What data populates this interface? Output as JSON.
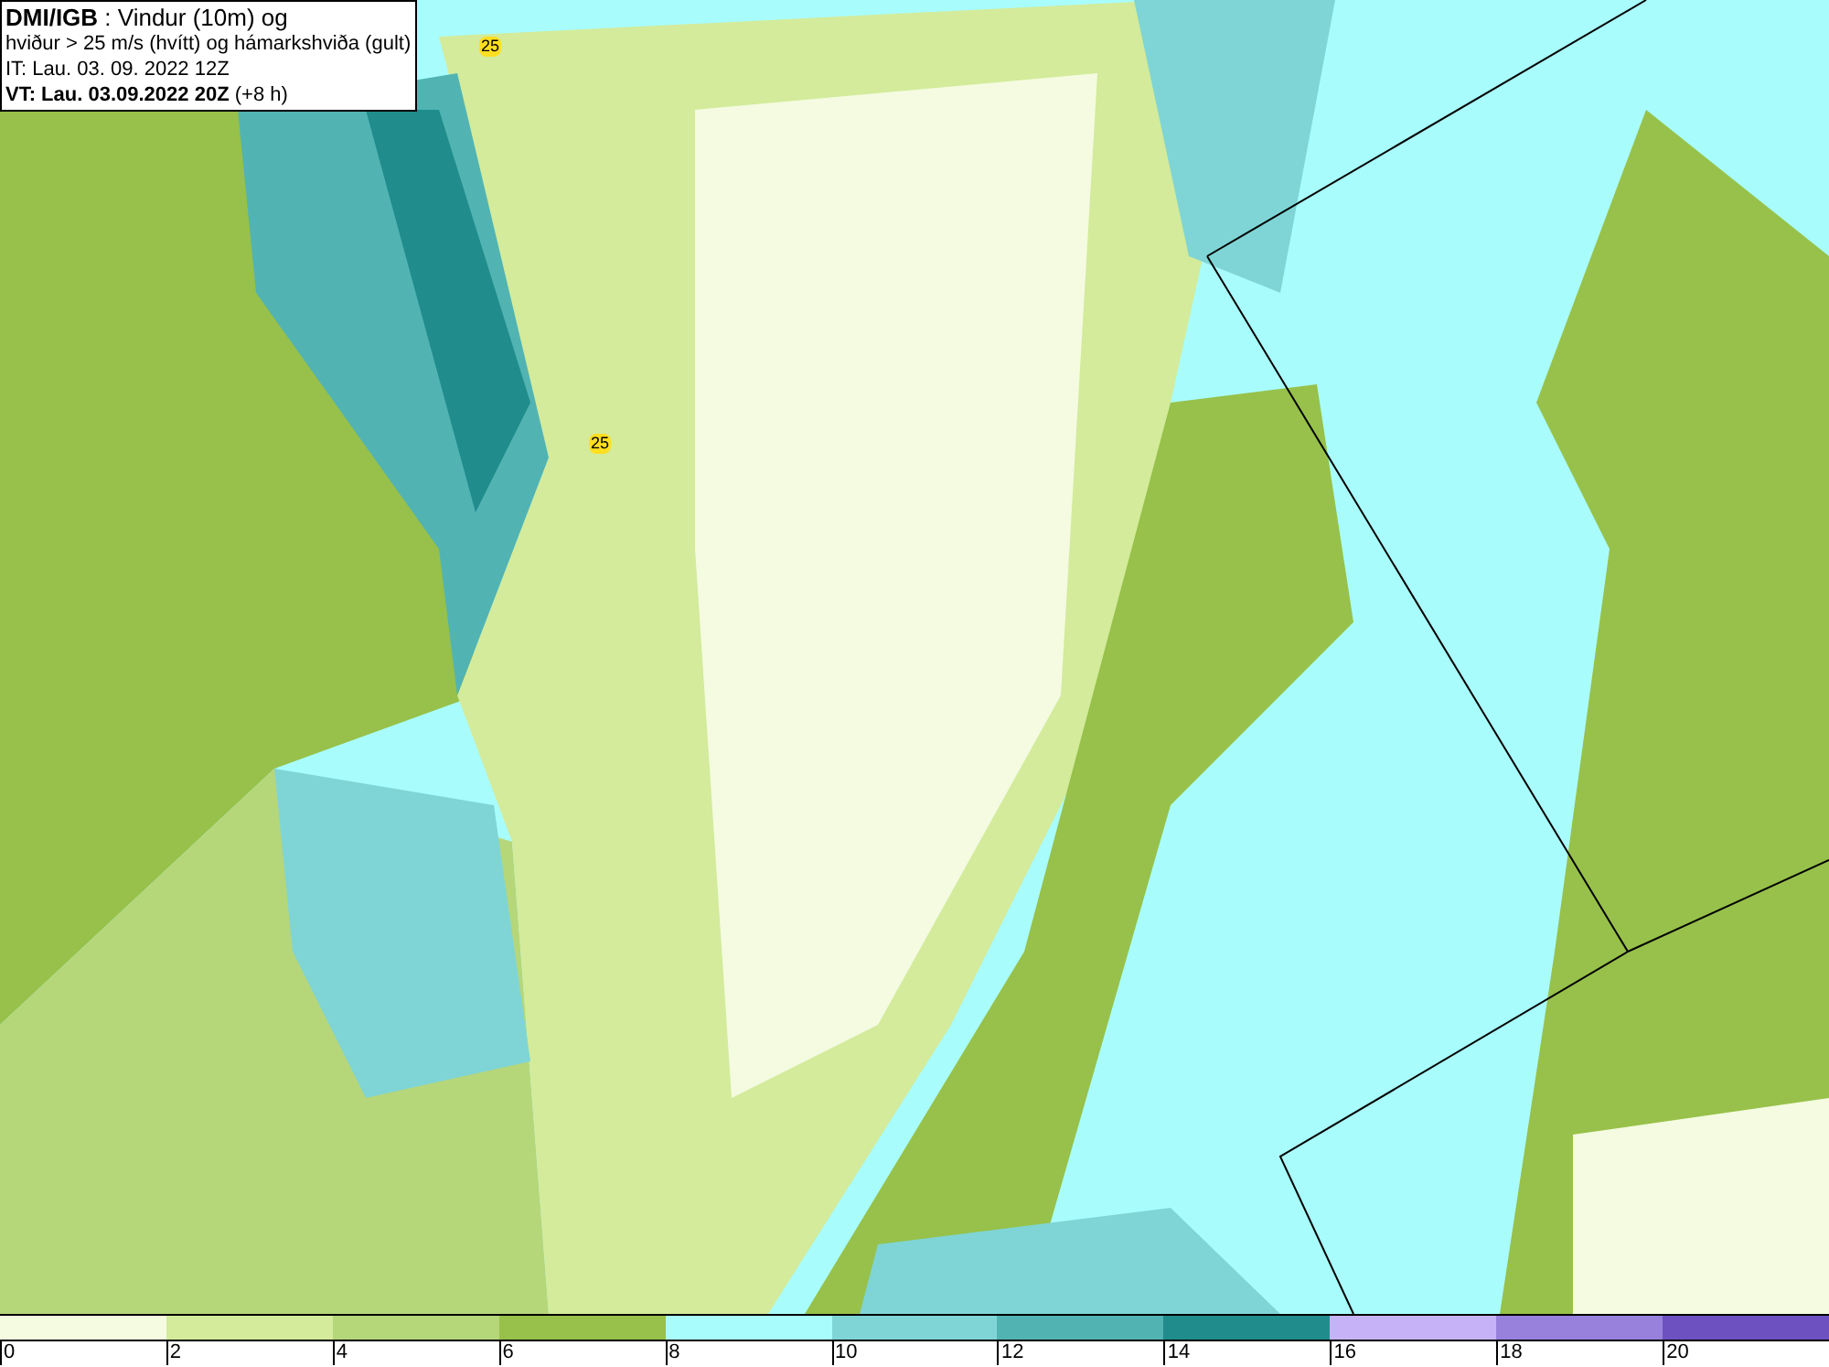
{
  "header": {
    "lines": [
      "**DMI/IGB** : Vindur (10m) og",
      "hviður > 25 m/s (hvítt) og hámarkshviða (gult)",
      "IT: Lau. 03. 09. 2022 12Z",
      "**VT: Lau. 03.09.2022 20Z** (+8 h)"
    ]
  },
  "map": {
    "gust_labels": [
      "25",
      "25"
    ]
  },
  "legend": {
    "bins": [
      {
        "color": "#f4fbe0"
      },
      {
        "color": "#d3eb9b"
      },
      {
        "color": "#b6d67a"
      },
      {
        "color": "#97c14a"
      },
      {
        "color": "#a9fcfc"
      },
      {
        "color": "#7fd5d5"
      },
      {
        "color": "#52b3b3"
      },
      {
        "color": "#208c8c"
      },
      {
        "color": "#c6b3f7"
      },
      {
        "color": "#9781dc"
      },
      {
        "color": "#6d51c0"
      }
    ],
    "ticks": [
      "0",
      "2",
      "4",
      "6",
      "8",
      "10",
      "12",
      "14",
      "16",
      "18",
      "20"
    ]
  }
}
